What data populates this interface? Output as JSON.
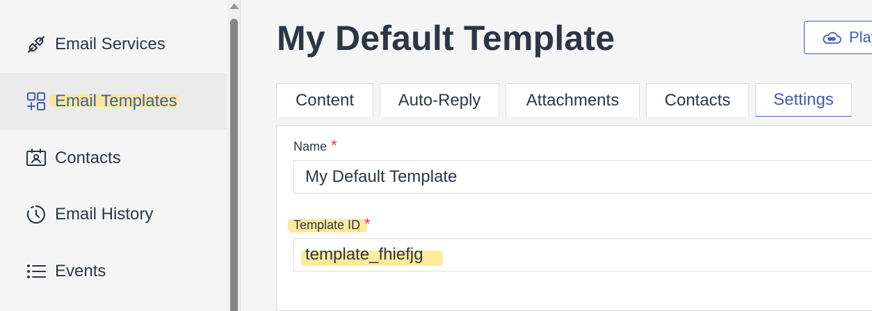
{
  "sidebar": {
    "items": [
      {
        "label": "Email Services",
        "icon": "plug-icon"
      },
      {
        "label": "Email Templates",
        "icon": "templates-grid-icon",
        "active": true
      },
      {
        "label": "Contacts",
        "icon": "contact-card-icon"
      },
      {
        "label": "Email History",
        "icon": "history-clock-icon"
      },
      {
        "label": "Events",
        "icon": "list-icon"
      }
    ]
  },
  "main": {
    "title": "My Default Template",
    "playground_button": "Play",
    "tabs": [
      {
        "label": "Content"
      },
      {
        "label": "Auto-Reply"
      },
      {
        "label": "Attachments"
      },
      {
        "label": "Contacts"
      },
      {
        "label": "Settings",
        "active": true
      }
    ],
    "form": {
      "name_label": "Name",
      "name_value": "My Default Template",
      "template_id_label": "Template ID",
      "template_id_value": "template_fhiefjg",
      "required_marker": "*"
    }
  },
  "colors": {
    "accent": "#3f5cb5",
    "text": "#2b3645",
    "required": "#e0334a",
    "highlight": "#fbe78a"
  }
}
